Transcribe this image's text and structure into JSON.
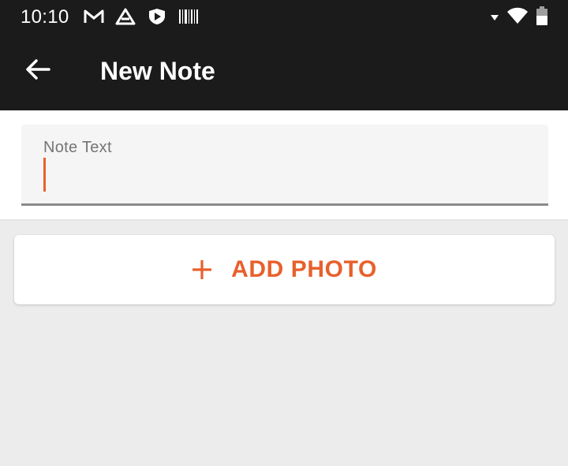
{
  "status_bar": {
    "time": "10:10",
    "left_icons": [
      "gmail-icon",
      "drive-icon",
      "shield-play-icon",
      "barcode-icon"
    ],
    "right_icons": [
      "signal-icon",
      "wifi-icon",
      "battery-icon"
    ]
  },
  "app_bar": {
    "title": "New Note",
    "back_icon": "arrow-back-icon"
  },
  "note_field": {
    "label": "Note Text",
    "value": ""
  },
  "add_photo": {
    "label": "ADD PHOTO",
    "icon": "plus-icon"
  },
  "colors": {
    "app_bar": "#1b1b1b",
    "accent": "#e8602c",
    "background": "#ececec"
  }
}
